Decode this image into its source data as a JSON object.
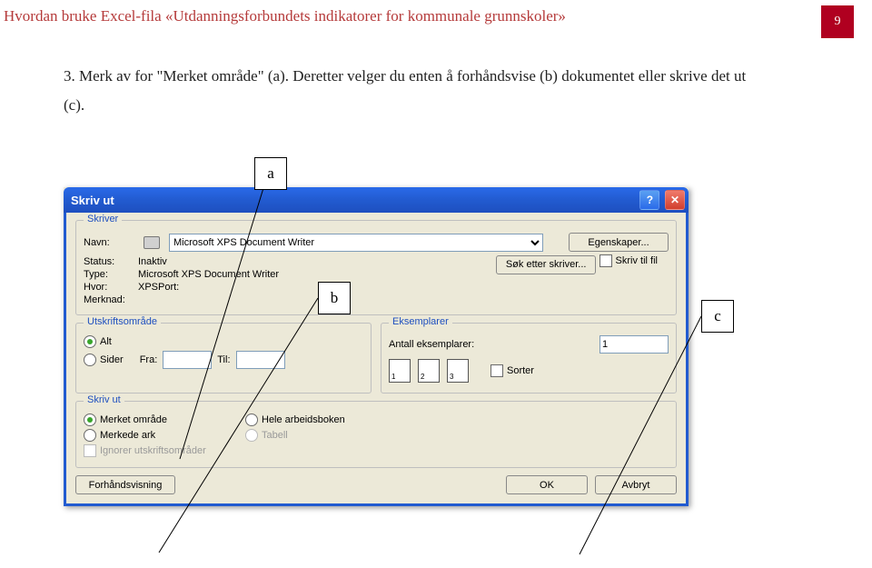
{
  "header": "Hvordan bruke Excel-fila «Utdanningsforbundets indikatorer for kommunale grunnskoler»",
  "page_number": "9",
  "body_text": "3. Merk av for \"Merket område\" (a). Deretter velger du enten å forhåndsvise (b) dokumentet eller skrive det ut (c).",
  "callouts": {
    "a": "a",
    "b": "b",
    "c": "c"
  },
  "dialog": {
    "title": "Skriv ut",
    "help_glyph": "?",
    "close_glyph": "✕",
    "printer_group": "Skriver",
    "name_label": "Navn:",
    "printer_name": "Microsoft XPS Document Writer",
    "properties_btn": "Egenskaper...",
    "find_printer_btn": "Søk etter skriver...",
    "status_label": "Status:",
    "status_value": "Inaktiv",
    "type_label": "Type:",
    "type_value": "Microsoft XPS Document Writer",
    "where_label": "Hvor:",
    "where_value": "XPSPort:",
    "comment_label": "Merknad:",
    "print_to_file": "Skriv til fil",
    "range_group": "Utskriftsområde",
    "range_all": "Alt",
    "range_pages": "Sider",
    "range_from": "Fra:",
    "range_to": "Til:",
    "copies_group": "Eksemplarer",
    "copies_label": "Antall eksemplarer:",
    "copies_value": "1",
    "collate": "Sorter",
    "printwhat_group": "Skriv ut",
    "sel_range": "Merket område",
    "workbook": "Hele arbeidsboken",
    "sel_sheets": "Merkede ark",
    "table": "Tabell",
    "ignore_areas": "Ignorer utskriftsområder",
    "preview_btn": "Forhåndsvisning",
    "ok_btn": "OK",
    "cancel_btn": "Avbryt"
  }
}
